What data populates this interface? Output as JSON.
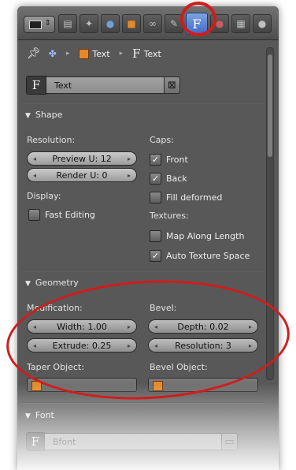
{
  "header": {
    "tabs": [
      {
        "icon": "render-layers-icon"
      },
      {
        "icon": "scene-icon"
      },
      {
        "icon": "world-icon"
      },
      {
        "icon": "object-icon"
      },
      {
        "icon": "constraints-icon"
      },
      {
        "icon": "modifiers-icon"
      },
      {
        "icon": "font-data-icon",
        "label": "F",
        "active": true
      },
      {
        "icon": "material-icon"
      },
      {
        "icon": "texture-icon"
      },
      {
        "icon": "physics-icon"
      }
    ]
  },
  "breadcrumb": {
    "object_name": "Text",
    "data_name": "Text",
    "data_glyph": "F"
  },
  "datablock": {
    "type_glyph": "F",
    "name": "Text",
    "clear_glyph": "⊠"
  },
  "shape": {
    "title": "Shape",
    "resolution_label": "Resolution:",
    "preview_u": "Preview U: 12",
    "render_u": "Render U: 0",
    "display_label": "Display:",
    "fast_editing": {
      "label": "Fast Editing",
      "checked": false
    },
    "caps_label": "Caps:",
    "front": {
      "label": "Front",
      "checked": true
    },
    "back": {
      "label": "Back",
      "checked": true
    },
    "fill_deformed": {
      "label": "Fill deformed",
      "checked": false
    },
    "textures_label": "Textures:",
    "map_along_length": {
      "label": "Map Along Length",
      "checked": false
    },
    "auto_texture_space": {
      "label": "Auto Texture Space",
      "checked": true
    }
  },
  "geometry": {
    "title": "Geometry",
    "modification_label": "Modification:",
    "width": "Width: 1.00",
    "extrude": "Extrude: 0.25",
    "bevel_label": "Bevel:",
    "depth": "Depth: 0.02",
    "resolution": "Resolution: 3",
    "taper_object_label": "Taper Object:",
    "bevel_object_label": "Bevel Object:"
  },
  "font": {
    "title": "Font",
    "font_name": "Bfont"
  },
  "colors": {
    "panel_bg": "#585858",
    "active_tab": "#4a77d0",
    "highlight": "#d21c1c"
  }
}
